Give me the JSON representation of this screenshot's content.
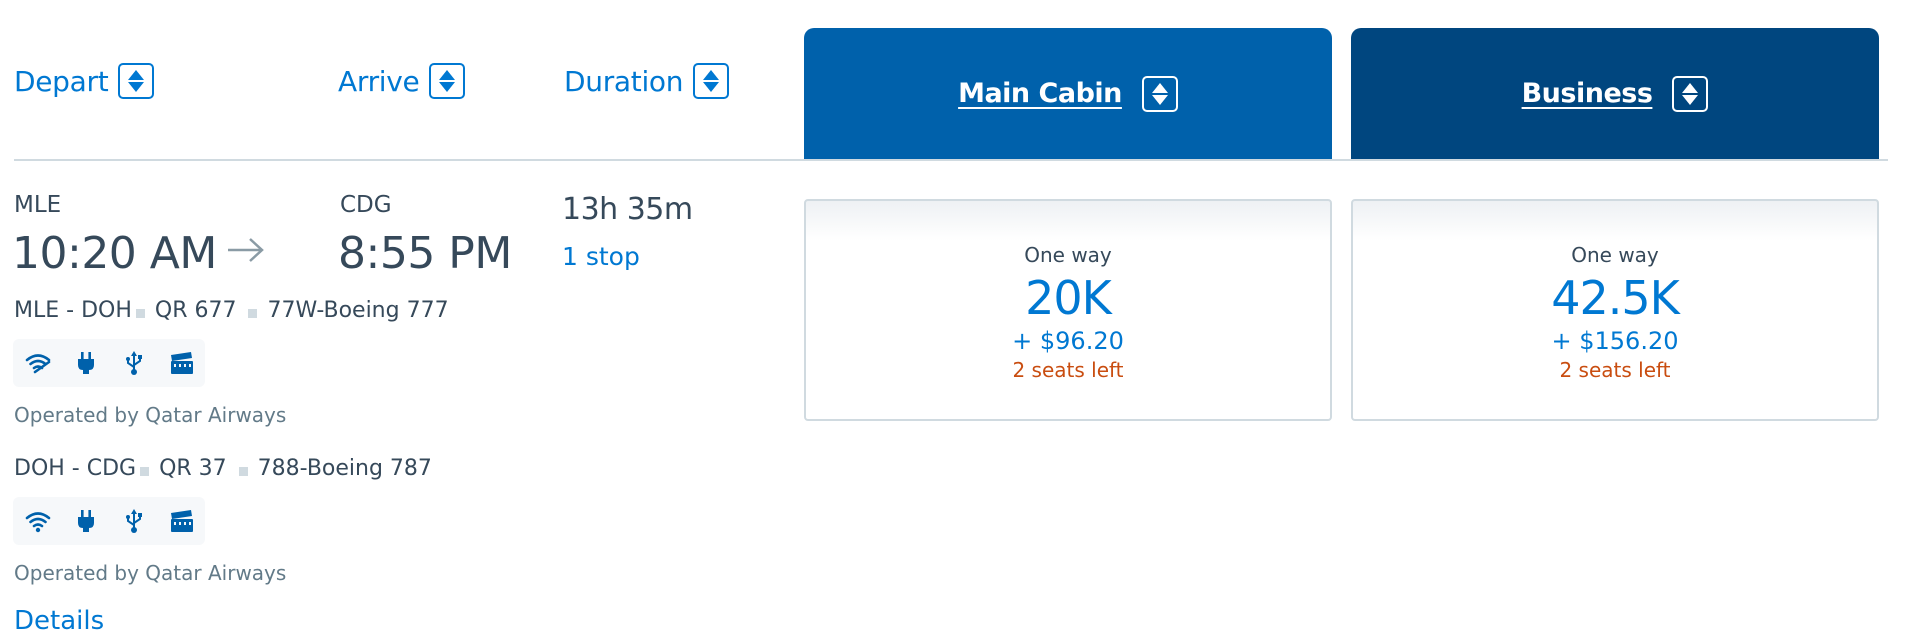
{
  "columns": {
    "depart": "Depart",
    "arrive": "Arrive",
    "duration": "Duration"
  },
  "cabins": [
    {
      "name": "Main Cabin",
      "color": "#0061ab",
      "fare": {
        "label": "One way",
        "miles": "20K",
        "cash": "+ $96.20",
        "seats": "2 seats left"
      }
    },
    {
      "name": "Business",
      "color": "#00467f",
      "fare": {
        "label": "One way",
        "miles": "42.5K",
        "cash": "+ $156.20",
        "seats": "2 seats left"
      }
    }
  ],
  "flight": {
    "origin": "MLE",
    "destination": "CDG",
    "depart_time": "10:20 AM",
    "arrive_time": "8:55 PM",
    "duration": "13h 35m",
    "stops": "1 stop",
    "segments": [
      {
        "route": "MLE - DOH",
        "flight_number": "QR 677",
        "aircraft": "77W-Boeing 777",
        "amenities": [
          "wifi-limited-icon",
          "power-outlet-icon",
          "usb-icon",
          "entertainment-icon"
        ],
        "operated_by": "Operated by Qatar Airways"
      },
      {
        "route": "DOH - CDG",
        "flight_number": "QR 37",
        "aircraft": "788-Boeing 787",
        "amenities": [
          "wifi-icon",
          "power-outlet-icon",
          "usb-icon",
          "entertainment-icon"
        ],
        "operated_by": "Operated by Qatar Airways"
      }
    ],
    "details_link": "Details"
  },
  "colors": {
    "link": "#0078d2",
    "text": "#36495a",
    "seats_warning": "#c94d10",
    "main_cabin": "#0061ab",
    "business": "#00467f"
  }
}
